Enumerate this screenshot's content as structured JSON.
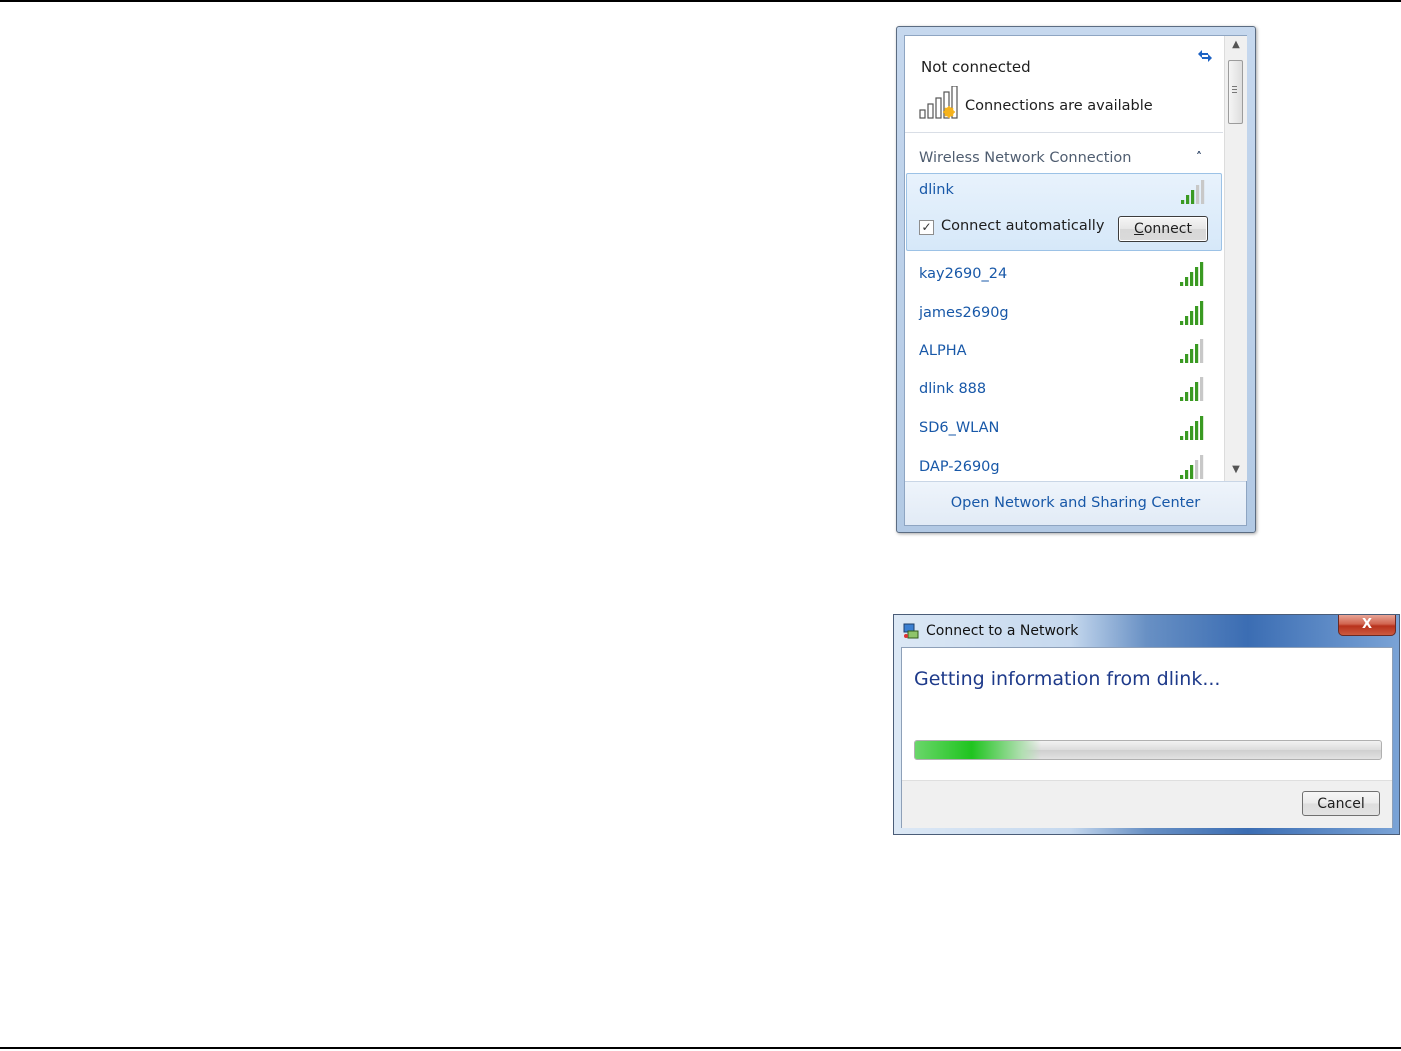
{
  "flyout": {
    "status_title": "Not connected",
    "status_subtitle": "Connections are available",
    "section_title": "Wireless Network Connection",
    "selected_network": {
      "name": "dlink",
      "connect_automatically_label": "Connect automatically",
      "connect_automatically_checked": true,
      "connect_button_label": "Connect",
      "connect_button_access_key": "C"
    },
    "networks": [
      {
        "name": "kay2690_24",
        "signal_bars": 5
      },
      {
        "name": "james2690g",
        "signal_bars": 5
      },
      {
        "name": "ALPHA",
        "signal_bars": 4
      },
      {
        "name": "dlink 888",
        "signal_bars": 4
      },
      {
        "name": "SD6_WLAN",
        "signal_bars": 5
      },
      {
        "name": "DAP-2690g",
        "signal_bars": 3
      }
    ],
    "footer_link": "Open Network and Sharing Center",
    "colors": {
      "link": "#1858a8",
      "signal_green": "#3a9a22"
    }
  },
  "dialog": {
    "title": "Connect to a Network",
    "close_label": "X",
    "message": "Getting information from dlink...",
    "progress": 0.27,
    "cancel_label": "Cancel"
  }
}
